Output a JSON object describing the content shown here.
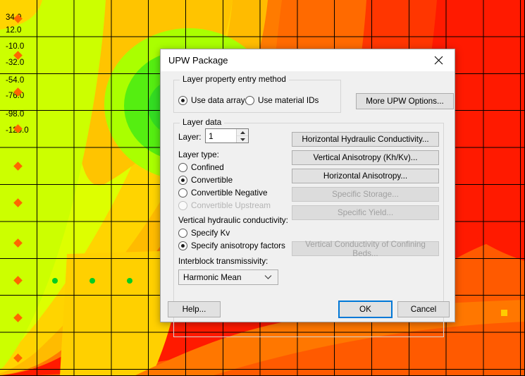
{
  "background": {
    "type": "groundwater-model-contour-map",
    "contour_labels": [
      "34.0",
      "12.0",
      "-10.0",
      "-32.0",
      "-54.0",
      "-76.0",
      "-98.0",
      "-120.0"
    ],
    "colors": {
      "green": "#55ee11",
      "yellow_green": "#ccff00",
      "yellow": "#ffdd00",
      "gold": "#ffbb00",
      "orange": "#ff8800",
      "dark_orange": "#ff5500",
      "red": "#ff1a00",
      "grid_line": "#000000",
      "diamond_marker": "#ff6600",
      "dot_marker": "#00cc22",
      "square_marker": "#ffcc00"
    }
  },
  "dialog": {
    "title": "UPW Package",
    "close_icon": "close-icon",
    "entry_method_group": {
      "title": "Layer property entry method",
      "options": [
        {
          "label": "Use data arrays",
          "checked": true,
          "disabled": false
        },
        {
          "label": "Use material IDs",
          "checked": false,
          "disabled": false
        }
      ],
      "more_options_button": "More UPW Options..."
    },
    "layer_data_group": {
      "title": "Layer data",
      "layer_label": "Layer:",
      "layer_value": "1",
      "layer_type_label": "Layer type:",
      "layer_types": [
        {
          "label": "Confined",
          "checked": false,
          "disabled": false
        },
        {
          "label": "Convertible",
          "checked": true,
          "disabled": false
        },
        {
          "label": "Convertible Negative",
          "checked": false,
          "disabled": false
        },
        {
          "label": "Convertible Upstream",
          "checked": false,
          "disabled": true
        }
      ],
      "vertical_k_label": "Vertical hydraulic conductivity:",
      "vertical_k_options": [
        {
          "label": "Specify Kv",
          "checked": false,
          "disabled": false
        },
        {
          "label": "Specify anisotropy factors",
          "checked": true,
          "disabled": false
        }
      ],
      "interblock_label": "Interblock transmissivity:",
      "interblock_value": "Harmonic Mean",
      "property_buttons": [
        {
          "label": "Horizontal Hydraulic Conductivity...",
          "disabled": false
        },
        {
          "label": "Vertical Anisotropy (Kh/Kv)...",
          "disabled": false
        },
        {
          "label": "Horizontal Anisotropy...",
          "disabled": false
        },
        {
          "label": "Specific Storage...",
          "disabled": true
        },
        {
          "label": "Specific Yield...",
          "disabled": true
        }
      ],
      "confining_beds_button": {
        "label": "Vertical Conductivity of Confining Beds...",
        "disabled": true
      }
    },
    "footer": {
      "help_label": "Help...",
      "ok_label": "OK",
      "cancel_label": "Cancel"
    },
    "accent_color": "#0078d7"
  }
}
